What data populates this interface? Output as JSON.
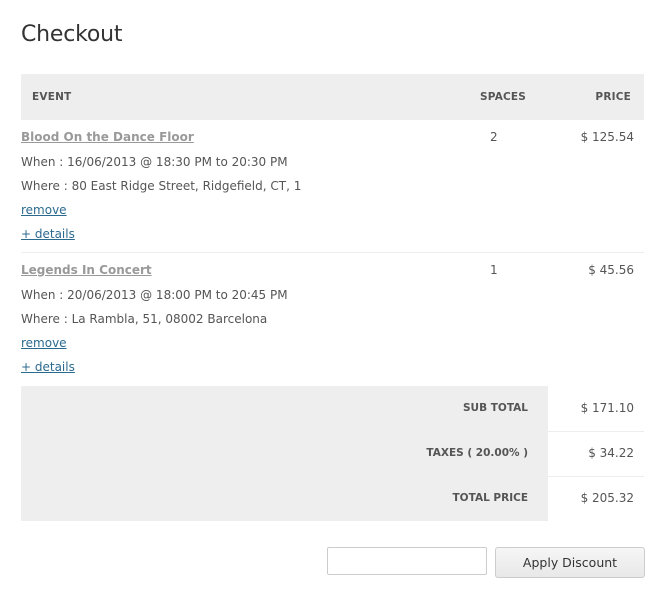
{
  "page": {
    "title": "Checkout"
  },
  "table": {
    "headers": {
      "event": "EVENT",
      "spaces": "SPACES",
      "price": "PRICE"
    },
    "items": [
      {
        "name": "Blood On the Dance Floor",
        "when_label": "When : ",
        "when": "16/06/2013 @ 18:30 PM to 20:30 PM",
        "where_label": "Where : ",
        "where": "80 East Ridge Street, Ridgefield, CT, 1",
        "remove_label": "remove",
        "details_label": "+ details",
        "spaces": "2",
        "price": "$ 125.54"
      },
      {
        "name": "Legends In Concert ",
        "when_label": "When : ",
        "when": "20/06/2013 @ 18:00 PM to 20:45 PM",
        "where_label": "Where : ",
        "where": "La Rambla, 51, 08002 Barcelona",
        "remove_label": "remove",
        "details_label": "+ details",
        "spaces": "1",
        "price": "$ 45.56"
      }
    ]
  },
  "totals": {
    "subtotal_label": "SUB TOTAL",
    "subtotal_value": "$ 171.10",
    "taxes_label": "TAXES ( 20.00% )",
    "taxes_value": "$ 34.22",
    "total_label": "TOTAL PRICE",
    "total_value": "$ 205.32"
  },
  "discount": {
    "input_value": "",
    "placeholder": "",
    "button_label": "Apply Discount"
  },
  "colors": {
    "header_bg": "#eeeeee",
    "link": "#2b6a8f",
    "event_title": "#999999"
  }
}
